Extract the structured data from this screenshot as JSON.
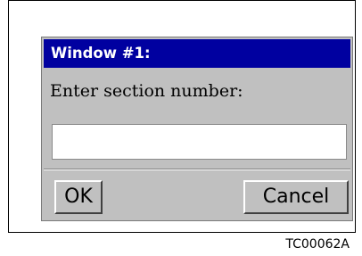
{
  "window": {
    "title": "Window #1:",
    "prompt": "Enter section number:",
    "input_value": "",
    "ok_label": "OK",
    "cancel_label": "Cancel"
  },
  "figure_code": "TC00062A",
  "colors": {
    "titlebar": "#0000a0",
    "dialog_background": "#c0c0c0",
    "input_background": "#ffffff"
  }
}
